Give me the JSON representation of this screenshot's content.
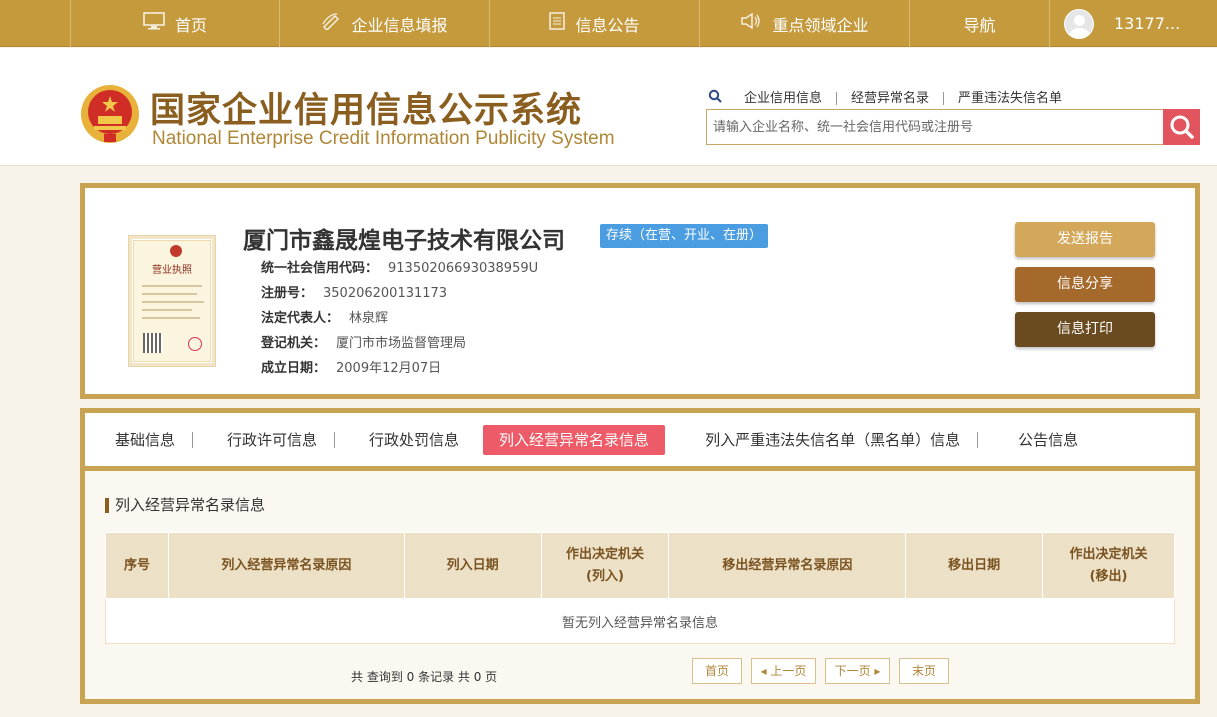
{
  "topnav": {
    "home": "首页",
    "fill": "企业信息填报",
    "notice": "信息公告",
    "key_enterprise": "重点领域企业",
    "guide": "导航",
    "user": "13177..."
  },
  "header": {
    "title_cn": "国家企业信用信息公示系统",
    "title_en": "National Enterprise Credit Information Publicity System",
    "search_tabs": [
      "企业信用信息",
      "经营异常名录",
      "严重违法失信名单"
    ],
    "search_placeholder": "请输入企业名称、统一社会信用代码或注册号"
  },
  "company": {
    "name": "厦门市鑫晟煌电子技术有限公司",
    "status": "存续（在营、开业、在册）",
    "license_title": "营业执照",
    "fields": [
      {
        "label": "统一社会信用代码：",
        "value": "91350206693038959U"
      },
      {
        "label": "注册号：",
        "value": "350206200131173"
      },
      {
        "label": "法定代表人：",
        "value": "林泉辉"
      },
      {
        "label": "登记机关：",
        "value": "厦门市市场监督管理局"
      },
      {
        "label": "成立日期：",
        "value": "2009年12月07日"
      }
    ],
    "buttons": {
      "report": "发送报告",
      "share": "信息分享",
      "print": "信息打印"
    }
  },
  "tabs": [
    "基础信息",
    "行政许可信息",
    "行政处罚信息",
    "列入经营异常名录信息",
    "列入严重违法失信名单（黑名单）信息",
    "公告信息"
  ],
  "section": {
    "title": "列入经营异常名录信息",
    "columns": [
      "序号",
      "列入经营异常名录原因",
      "列入日期",
      "作出决定机关\n(列入)",
      "移出经营异常名录原因",
      "移出日期",
      "作出决定机关\n(移出)"
    ],
    "empty_text": "暂无列入经营异常名录信息"
  },
  "pager": {
    "info": "共 查询到 0 条记录 共 0 页",
    "first": "首页",
    "prev": "◂ 上一页",
    "next": "下一页 ▸",
    "last": "末页"
  },
  "colors": {
    "gold": "#c49a3d",
    "frame": "#c8a452",
    "active_tab": "#ec5b67",
    "badge": "#4a9de0"
  }
}
